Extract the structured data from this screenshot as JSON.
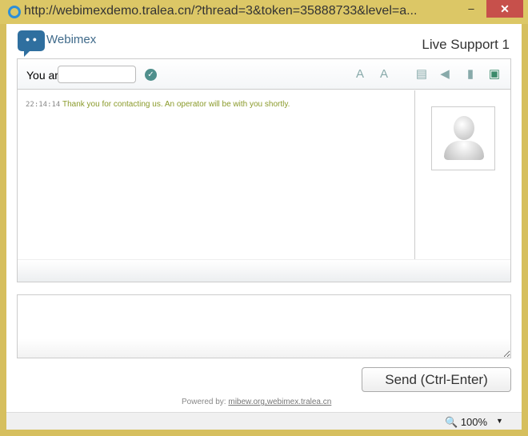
{
  "window": {
    "title": "http://webimexdemo.tralea.cn/?thread=3&token=35888733&level=a...",
    "minimize": "–",
    "maximize": "□",
    "close": "✕"
  },
  "header": {
    "brand": "Webimex",
    "support_title": "Live Support 1"
  },
  "toolbar": {
    "name_label": "You are",
    "name_value": "",
    "icons": [
      "font-decrease-icon",
      "font-increase-icon",
      "history-icon",
      "sound-icon",
      "refresh-icon",
      "close-chat-icon"
    ]
  },
  "messages": [
    {
      "time": "22:14:14",
      "text": "Thank you for contacting us. An operator will be with you shortly."
    }
  ],
  "compose": {
    "value": "",
    "send_label": "Send (Ctrl-Enter)"
  },
  "footer": {
    "powered_label": "Powered by:",
    "links": "mibew.org,webimex.tralea.cn"
  },
  "statusbar": {
    "zoom": "100%"
  }
}
